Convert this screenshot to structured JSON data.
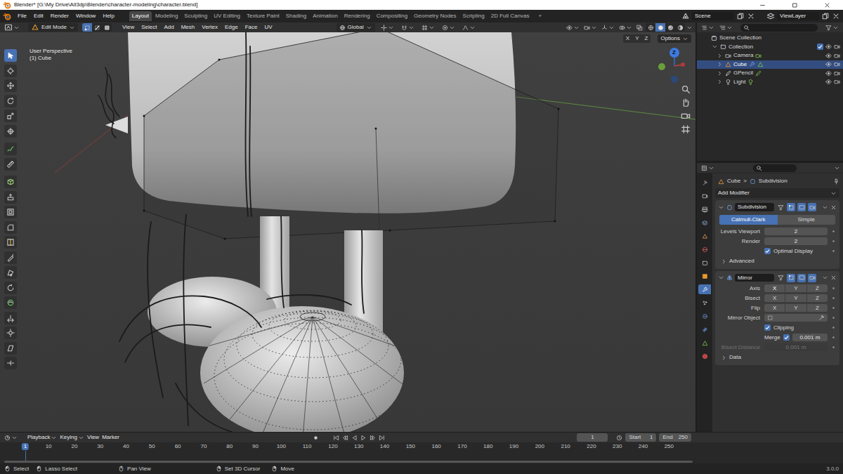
{
  "window": {
    "title": "Blender* [G:\\My Drive\\All3dp\\Blender\\character-modeling\\character.blend]"
  },
  "menu": [
    "File",
    "Edit",
    "Render",
    "Window",
    "Help"
  ],
  "workspaces": [
    {
      "label": "Layout",
      "selected": true
    },
    {
      "label": "Modeling",
      "selected": false
    },
    {
      "label": "Sculpting",
      "selected": false
    },
    {
      "label": "UV Editing",
      "selected": false
    },
    {
      "label": "Texture Paint",
      "selected": false
    },
    {
      "label": "Shading",
      "selected": false
    },
    {
      "label": "Animation",
      "selected": false
    },
    {
      "label": "Rendering",
      "selected": false
    },
    {
      "label": "Compositing",
      "selected": false
    },
    {
      "label": "Geometry Nodes",
      "selected": false
    },
    {
      "label": "Scripting",
      "selected": false
    },
    {
      "label": "2D Full Canvas",
      "selected": false
    }
  ],
  "workspace_add": "+",
  "scene": "Scene",
  "view_layer": "ViewLayer",
  "viewport_header": {
    "mode": "Edit Mode",
    "select_modes": [
      {
        "selected": true
      },
      {
        "selected": false
      },
      {
        "selected": false
      }
    ],
    "menus": [
      "View",
      "Select",
      "Add",
      "Mesh",
      "Vertex",
      "Edge",
      "Face",
      "UV"
    ],
    "orientation": "Global",
    "shading": [
      {
        "selected": false
      },
      {
        "selected": true
      },
      {
        "selected": false
      },
      {
        "selected": false
      }
    ],
    "mirror_axes": [
      {
        "label": "X",
        "selected": false
      },
      {
        "label": "Y",
        "selected": false
      },
      {
        "label": "Z",
        "selected": false
      }
    ],
    "options": "Options"
  },
  "viewport": {
    "view_name": "User Perspective",
    "object": "(1) Cube",
    "gizmo_axis": "Z"
  },
  "tools": [
    {
      "selected": true
    },
    {
      "selected": false
    },
    {
      "selected": false
    },
    {
      "selected": false
    },
    {
      "selected": false
    },
    {
      "selected": false
    },
    {
      "selected": false
    },
    {
      "selected": false
    },
    {
      "selected": false
    },
    {
      "selected": false
    },
    {
      "selected": false
    },
    {
      "selected": false
    },
    {
      "selected": false
    },
    {
      "selected": false
    },
    {
      "selected": false
    },
    {
      "selected": false
    },
    {
      "selected": false
    },
    {
      "selected": false
    },
    {
      "selected": false
    },
    {
      "selected": false
    },
    {
      "selected": false
    }
  ],
  "outliner": {
    "root": "Scene Collection",
    "collection": {
      "label": "Collection",
      "expanded": true,
      "checked": true,
      "visible": true,
      "renderable": true
    },
    "objects": [
      {
        "label": "Camera",
        "selected": false,
        "expanded": false,
        "visible": true,
        "renderable": true
      },
      {
        "label": "Cube",
        "selected": true,
        "expanded": false,
        "visible": true,
        "renderable": true
      },
      {
        "label": "GPencil",
        "selected": false,
        "expanded": false,
        "visible": true,
        "renderable": true
      },
      {
        "label": "Light",
        "selected": false,
        "expanded": false,
        "visible": true,
        "renderable": true
      }
    ]
  },
  "properties": {
    "tabs": [
      {
        "selected": false
      },
      {
        "selected": false
      },
      {
        "selected": false
      },
      {
        "selected": false
      },
      {
        "selected": false
      },
      {
        "selected": false
      },
      {
        "selected": false
      },
      {
        "selected": false
      },
      {
        "selected": true
      },
      {
        "selected": false
      },
      {
        "selected": false
      },
      {
        "selected": false
      },
      {
        "selected": false
      },
      {
        "selected": false
      }
    ],
    "breadcrumb": {
      "object": "Cube",
      "separator": ">",
      "modifier": "Subdivision"
    },
    "add_modifier": "Add Modifier",
    "subdivision": {
      "name": "Subdivision",
      "expanded": true,
      "toggles": [
        {
          "selected": false
        },
        {
          "selected": true
        },
        {
          "selected": true
        },
        {
          "selected": true
        }
      ],
      "types": [
        {
          "label": "Catmull-Clark",
          "selected": true
        },
        {
          "label": "Simple",
          "selected": false
        }
      ],
      "fields": [
        {
          "label": "Levels Viewport",
          "value": "2"
        },
        {
          "label": "Render",
          "value": "2"
        }
      ],
      "optimal_display": {
        "label": "Optimal Display",
        "checked": true
      },
      "advanced": {
        "label": "Advanced",
        "expanded": false
      }
    },
    "mirror": {
      "name": "Mirror",
      "expanded": true,
      "toggles": [
        {
          "selected": false
        },
        {
          "selected": true
        },
        {
          "selected": true
        },
        {
          "selected": true
        }
      ],
      "axis_rows": [
        {
          "label": "Axis",
          "buttons": [
            {
              "label": "X",
              "selected": true
            },
            {
              "label": "Y",
              "selected": false
            },
            {
              "label": "Z",
              "selected": false
            }
          ]
        },
        {
          "label": "Bisect",
          "buttons": [
            {
              "label": "X",
              "selected": false
            },
            {
              "label": "Y",
              "selected": false
            },
            {
              "label": "Z",
              "selected": false
            }
          ]
        },
        {
          "label": "Flip",
          "buttons": [
            {
              "label": "X",
              "selected": false
            },
            {
              "label": "Y",
              "selected": false
            },
            {
              "label": "Z",
              "selected": false
            }
          ]
        }
      ],
      "mirror_object": {
        "label": "Mirror Object"
      },
      "clipping": {
        "label": "Clipping",
        "checked": true
      },
      "merge": {
        "label": "Merge",
        "checked": true,
        "value": "0.001 m"
      },
      "bisect_distance": {
        "label": "Bisect Distance",
        "value": "0.001 m",
        "disabled": true
      },
      "data": {
        "label": "Data",
        "expanded": false
      }
    }
  },
  "timeline": {
    "menus": [
      "Playback",
      "Keying",
      "View",
      "Marker"
    ],
    "current_frame": "1",
    "start_label": "Start",
    "start": "1",
    "end_label": "End",
    "end": "250",
    "ruler": [
      {
        "label": "1",
        "selected": true
      },
      {
        "label": "10",
        "selected": false
      },
      {
        "label": "20",
        "selected": false
      },
      {
        "label": "30",
        "selected": false
      },
      {
        "label": "40",
        "selected": false
      },
      {
        "label": "50",
        "selected": false
      },
      {
        "label": "60",
        "selected": false
      },
      {
        "label": "70",
        "selected": false
      },
      {
        "label": "80",
        "selected": false
      },
      {
        "label": "90",
        "selected": false
      },
      {
        "label": "100",
        "selected": false
      },
      {
        "label": "110",
        "selected": false
      },
      {
        "label": "120",
        "selected": false
      },
      {
        "label": "130",
        "selected": false
      },
      {
        "label": "140",
        "selected": false
      },
      {
        "label": "150",
        "selected": false
      },
      {
        "label": "160",
        "selected": false
      },
      {
        "label": "170",
        "selected": false
      },
      {
        "label": "180",
        "selected": false
      },
      {
        "label": "190",
        "selected": false
      },
      {
        "label": "200",
        "selected": false
      },
      {
        "label": "210",
        "selected": false
      },
      {
        "label": "220",
        "selected": false
      },
      {
        "label": "230",
        "selected": false
      },
      {
        "label": "240",
        "selected": false
      },
      {
        "label": "250",
        "selected": false
      }
    ]
  },
  "status_bar": {
    "items": [
      "Select",
      "Lasso Select",
      "Pan View",
      "Set 3D Cursor",
      "Move"
    ],
    "version": "3.0.0"
  }
}
